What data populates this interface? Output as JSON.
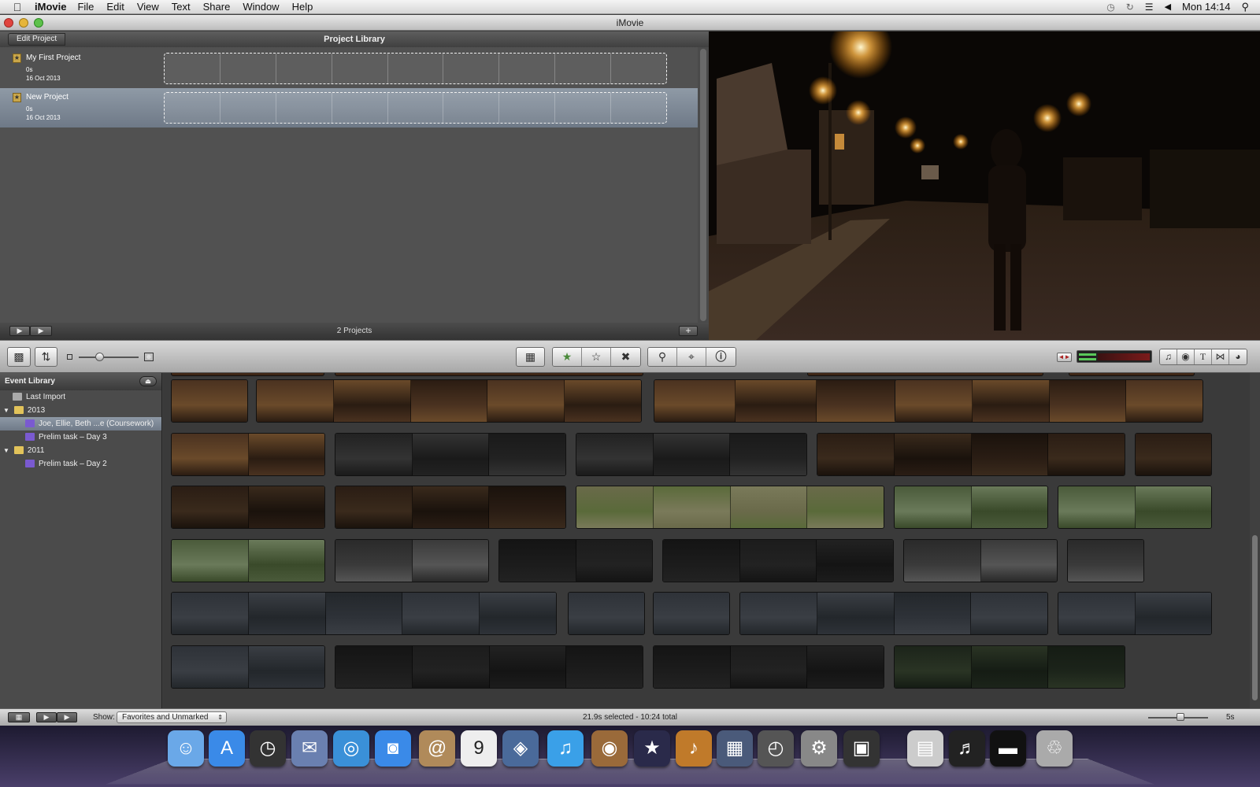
{
  "menubar": {
    "apple": "",
    "app": "iMovie",
    "items": [
      "File",
      "Edit",
      "View",
      "Text",
      "Share",
      "Window",
      "Help"
    ],
    "clock": "Mon 14:14"
  },
  "window": {
    "title": "iMovie"
  },
  "project_library": {
    "edit_button": "Edit Project",
    "title": "Project Library",
    "projects": [
      {
        "name": "My First Project",
        "duration": "0s",
        "date": "16 Oct 2013"
      },
      {
        "name": "New Project",
        "duration": "0s",
        "date": "16 Oct 2013"
      }
    ],
    "count": "2 Projects",
    "add": "+"
  },
  "event_library": {
    "title": "Event Library",
    "items": [
      {
        "label": "Last Import"
      },
      {
        "label": "2013"
      },
      {
        "label": "Joe, Ellie, Beth ...e (Coursework)"
      },
      {
        "label": "Prelim task – Day 3"
      },
      {
        "label": "2011"
      },
      {
        "label": "Prelim task – Day 2"
      }
    ]
  },
  "bottombar": {
    "show_label": "Show:",
    "show_value": "Favorites and Unmarked",
    "selection": "21.9s selected - 10:24 total",
    "zoom": "5s"
  },
  "colors": {
    "selection": "#7f8a98",
    "accent_green": "#5ac85a",
    "viewer_glow": "#ffb84a"
  },
  "icons": {
    "toolbar": [
      "camera-icon",
      "swap-icon",
      "thumbnail-size-slider",
      "person-icon",
      "add-to-project-icon",
      "favorite-star-icon",
      "unmark-star-icon",
      "reject-x-icon",
      "voiceover-mic-icon",
      "crop-icon",
      "info-icon",
      "audio-skim-icon",
      "volume-meter",
      "music-icon",
      "photo-icon",
      "title-icon",
      "transition-icon",
      "map-icon"
    ],
    "dock": [
      "finder-icon",
      "app-store-icon",
      "dashboard-icon",
      "mail-icon",
      "safari-icon",
      "facetime-icon",
      "address-book-icon",
      "ical-icon",
      "iphoto-booth-icon",
      "itunes-icon",
      "photo-booth-icon",
      "imovie-icon",
      "garageband-icon",
      "mission-control-icon",
      "time-machine-icon",
      "system-prefs-icon",
      "clapper-icon",
      "preview-icon",
      "music-folder-icon",
      "screen-icon",
      "trash-icon"
    ]
  }
}
